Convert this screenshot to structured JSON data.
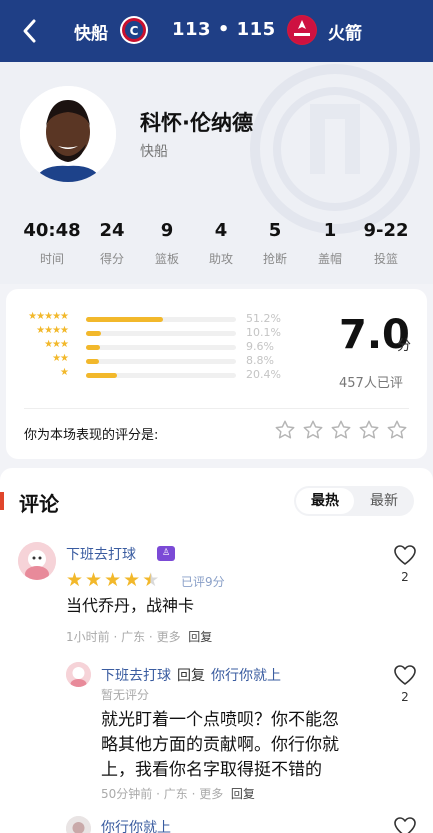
{
  "header": {
    "home_team": "快船",
    "score": "113 • 115",
    "away_team": "火箭",
    "colors": {
      "bar": "#1f3f86"
    }
  },
  "player": {
    "name": "科怀·伦纳德",
    "team": "快船",
    "stats": [
      {
        "value": "40:48",
        "label": "时间"
      },
      {
        "value": "24",
        "label": "得分"
      },
      {
        "value": "9",
        "label": "篮板"
      },
      {
        "value": "4",
        "label": "助攻"
      },
      {
        "value": "5",
        "label": "抢断"
      },
      {
        "value": "1",
        "label": "盖帽"
      },
      {
        "value": "9-22",
        "label": "投篮"
      }
    ]
  },
  "rating": {
    "score": "7.0",
    "unit": "分",
    "count_text": "457人已评",
    "distribution": [
      {
        "stars": 5,
        "fraction": 0.512,
        "percent": "51.2%"
      },
      {
        "stars": 4,
        "fraction": 0.101,
        "percent": "10.1%"
      },
      {
        "stars": 3,
        "fraction": 0.096,
        "percent": "9.6%"
      },
      {
        "stars": 2,
        "fraction": 0.088,
        "percent": "8.8%"
      },
      {
        "stars": 1,
        "fraction": 0.204,
        "percent": "20.4%"
      }
    ],
    "your_rating_label": "你为本场表现的评分是:",
    "star_color": "#f2b82b"
  },
  "comments": {
    "title": "评论",
    "sort_hot": "最热",
    "sort_new": "最新",
    "list": [
      {
        "user": "下班去打球",
        "stars": 4.5,
        "rated_text": "已评9分",
        "text": "当代乔丹，战神卡",
        "time": "1小时前",
        "location": "广东",
        "more": "更多",
        "reply": "回复",
        "likes": "2"
      },
      {
        "user": "下班去打球",
        "reply_word": "回复",
        "reply_to": "你行你就上",
        "no_rating": "暂无评分",
        "text_line1": "就光盯着一个点喷呗？你不能忽",
        "text_line2": "略其他方面的贡献啊。你行你就",
        "text_line3": "上，我看你名字取得挺不错的",
        "time": "50分钟前",
        "location": "广东",
        "more": "更多",
        "reply": "回复",
        "likes": "2"
      },
      {
        "user": "你行你就上"
      }
    ]
  }
}
